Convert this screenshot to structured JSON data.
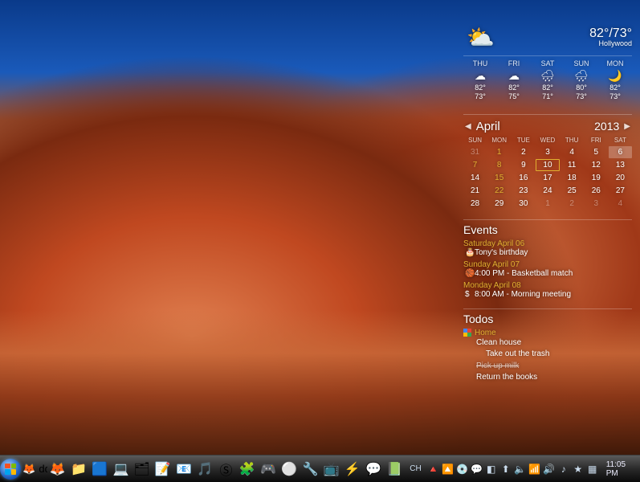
{
  "weather": {
    "now_temp": "82°/73°",
    "now_loc": "Hollywood",
    "now_icon": "⛅",
    "forecast": [
      {
        "day": "THU",
        "icon": "☁",
        "hi": "82°",
        "lo": "73°"
      },
      {
        "day": "FRI",
        "icon": "☁",
        "hi": "82°",
        "lo": "75°"
      },
      {
        "day": "SAT",
        "icon": "🌧",
        "hi": "82°",
        "lo": "71°"
      },
      {
        "day": "SUN",
        "icon": "🌧",
        "hi": "80°",
        "lo": "73°"
      },
      {
        "day": "MON",
        "icon": "🌙",
        "hi": "82°",
        "lo": "73°"
      }
    ]
  },
  "calendar": {
    "month": "April",
    "year": "2013",
    "dow": [
      "SUN",
      "MON",
      "TUE",
      "WED",
      "THU",
      "FRI",
      "SAT"
    ],
    "cells": [
      {
        "n": 31,
        "dim": true
      },
      {
        "n": 1,
        "evt": true
      },
      {
        "n": 2
      },
      {
        "n": 3
      },
      {
        "n": 4
      },
      {
        "n": 5
      },
      {
        "n": 6,
        "sel": true
      },
      {
        "n": 7,
        "evt": true
      },
      {
        "n": 8,
        "evt": true
      },
      {
        "n": 9
      },
      {
        "n": 10,
        "today": true
      },
      {
        "n": 11
      },
      {
        "n": 12
      },
      {
        "n": 13
      },
      {
        "n": 14
      },
      {
        "n": 15,
        "evt": true
      },
      {
        "n": 16
      },
      {
        "n": 17
      },
      {
        "n": 18
      },
      {
        "n": 19
      },
      {
        "n": 20
      },
      {
        "n": 21
      },
      {
        "n": 22,
        "evt": true
      },
      {
        "n": 23
      },
      {
        "n": 24
      },
      {
        "n": 25
      },
      {
        "n": 26
      },
      {
        "n": 27
      },
      {
        "n": 28
      },
      {
        "n": 29
      },
      {
        "n": 30
      },
      {
        "n": 1,
        "dim": true
      },
      {
        "n": 2,
        "dim": true
      },
      {
        "n": 3,
        "dim": true
      },
      {
        "n": 4,
        "dim": true
      }
    ]
  },
  "events": {
    "title": "Events",
    "groups": [
      {
        "date": "Saturday April 06",
        "icon": "🎂",
        "text": "Tony's birthday"
      },
      {
        "date": "Sunday April 07",
        "icon": "🏀",
        "text": "4:00 PM - Basketball match"
      },
      {
        "date": "Monday April 08",
        "icon": "$",
        "text": "8:00 AM - Morning meeting"
      }
    ]
  },
  "todos": {
    "title": "Todos",
    "category": "Home",
    "items": [
      {
        "text": "Clean house",
        "done": false,
        "sub": false
      },
      {
        "text": "Take out the trash",
        "done": false,
        "sub": true
      },
      {
        "text": "Pick up milk",
        "done": true,
        "sub": false
      },
      {
        "text": "Return the books",
        "done": false,
        "sub": false
      }
    ]
  },
  "taskbar": {
    "quicklaunch": [
      "🦊",
      "dd"
    ],
    "pinned": [
      "🦊",
      "📁",
      "🟦",
      "💻",
      "🗂",
      "📝",
      "📧",
      "🎵",
      "Ⓢ",
      "🧩",
      "🎮",
      "⚪",
      "🔧",
      "📺",
      "⚡",
      "💬",
      "📗"
    ],
    "lang": "CH",
    "tray_icons": [
      "🔺",
      "🔼",
      "💿",
      "💬",
      "◧",
      "⬆",
      "🔈",
      "📶",
      "🔊",
      "♪",
      "★",
      "▦"
    ],
    "time": "11:05 PM"
  }
}
